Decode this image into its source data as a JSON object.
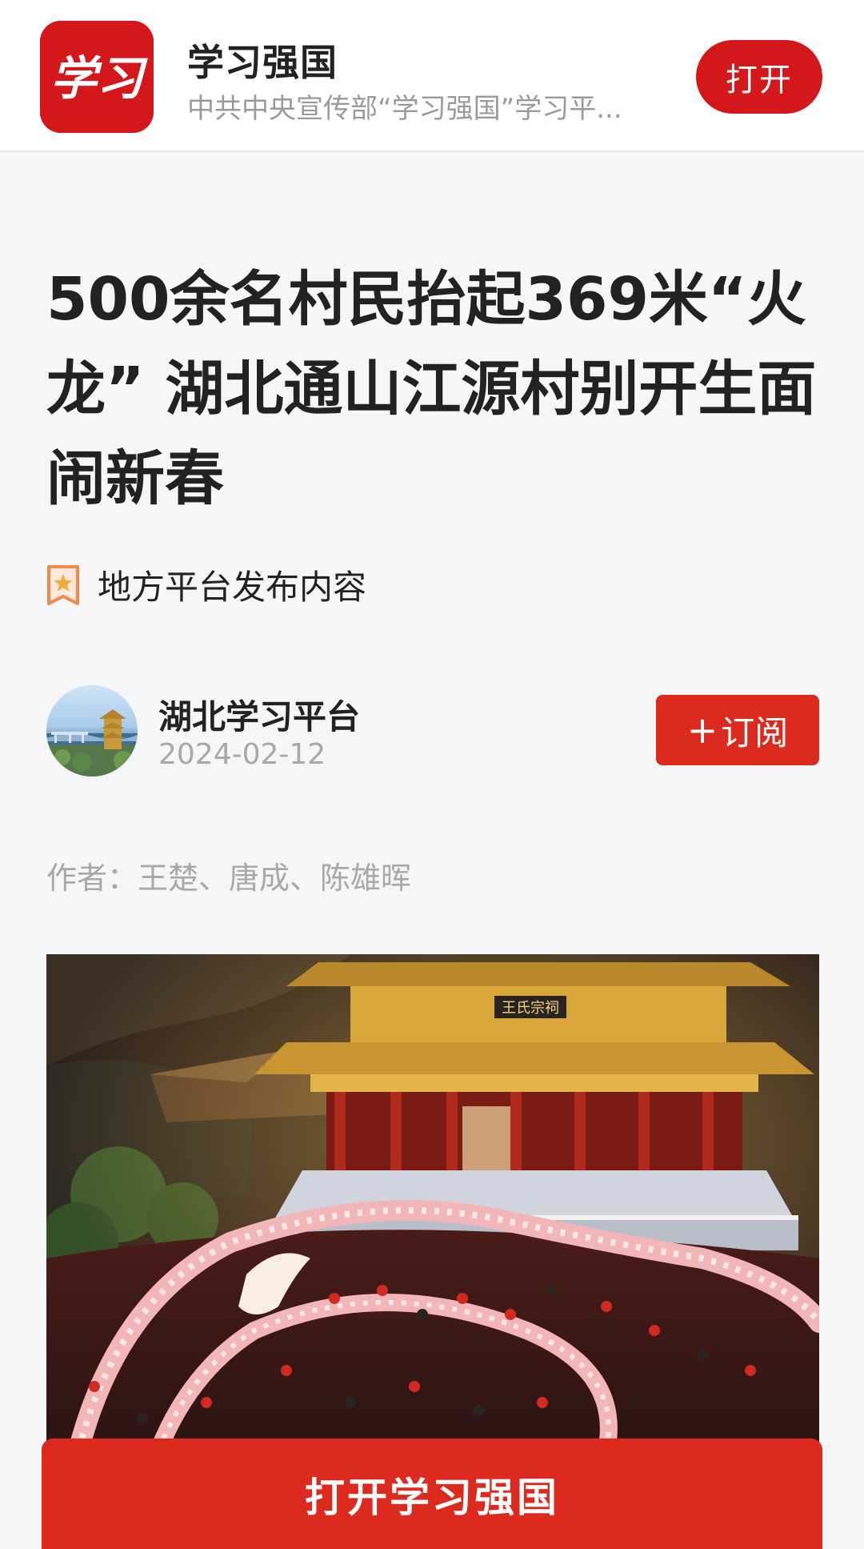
{
  "app_banner": {
    "logo_text": "学习",
    "name": "学习强国",
    "description": "中共中央宣传部“学习强国”学习平...",
    "open_label": "打开"
  },
  "article": {
    "title": "500余名村民抬起369米“火龙” 湖北通山江源村别开生面闹新春",
    "source_tag": "地方平台发布内容",
    "account_name": "湖北学习平台",
    "publish_date": "2024-02-12",
    "subscribe_plus": "+",
    "subscribe_label": "订阅",
    "byline": "作者：王楚、唐成、陈雄晖",
    "hero_sign_text": "王氏宗祠"
  },
  "cta": {
    "label": "打开学习强国"
  },
  "colors": {
    "brand_red": "#d3171b",
    "button_red": "#dc2b1e",
    "tag_orange": "#f08a4b"
  },
  "icons": {
    "tag": "star-badge-icon"
  }
}
